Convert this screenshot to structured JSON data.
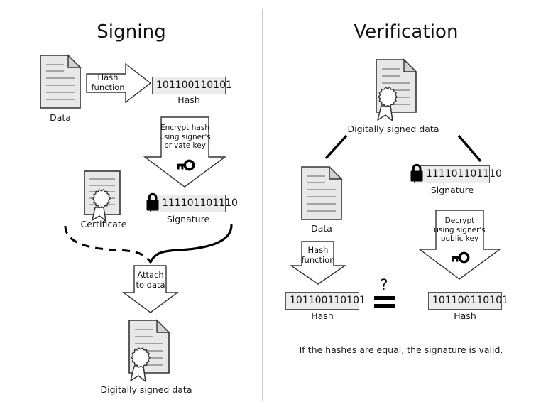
{
  "diagram": {
    "title_left": "Signing",
    "title_right": "Verification",
    "divider": true,
    "colors": {
      "box_fill": "#ececec",
      "box_border": "#555555",
      "doc_fill": "#e8e8e8",
      "doc_border": "#333333",
      "arrow_fill": "#ffffff",
      "arrow_border": "#333333",
      "divider": "#c9c9c9",
      "text": "#1a1a1a"
    }
  },
  "signing": {
    "title": "Signing",
    "data_label": "Data",
    "hash_function_arrow": "Hash function",
    "hash_function_line1": "Hash",
    "hash_function_line2": "function",
    "hash_value": "101100110101",
    "hash_label": "Hash",
    "encrypt_line1": "Encrypt hash",
    "encrypt_line2": "using signer's",
    "encrypt_line3": "private key",
    "key_icon": "key-icon",
    "certificate_label": "Certificate",
    "signature_value": "111101101110",
    "signature_label": "Signature",
    "lock_icon": "padlock-icon",
    "attach_line1": "Attach",
    "attach_line2": "to data",
    "signed_data_label": "Digitally signed data"
  },
  "verification": {
    "title": "Verification",
    "signed_data_label": "Digitally signed data",
    "data_label": "Data",
    "signature_value": "111101101110",
    "signature_label": "Signature",
    "lock_icon": "padlock-icon",
    "hash_function_line1": "Hash",
    "hash_function_line2": "function",
    "decrypt_line1": "Decrypt",
    "decrypt_line2": "using signer's",
    "decrypt_line3": "public key",
    "key_icon": "key-icon",
    "hash_left_value": "101100110101",
    "hash_left_label": "Hash",
    "hash_right_value": "101100110101",
    "hash_right_label": "Hash",
    "compare_question": "?",
    "compare_equals": "=",
    "conclusion": "If the hashes are equal, the signature is valid."
  }
}
